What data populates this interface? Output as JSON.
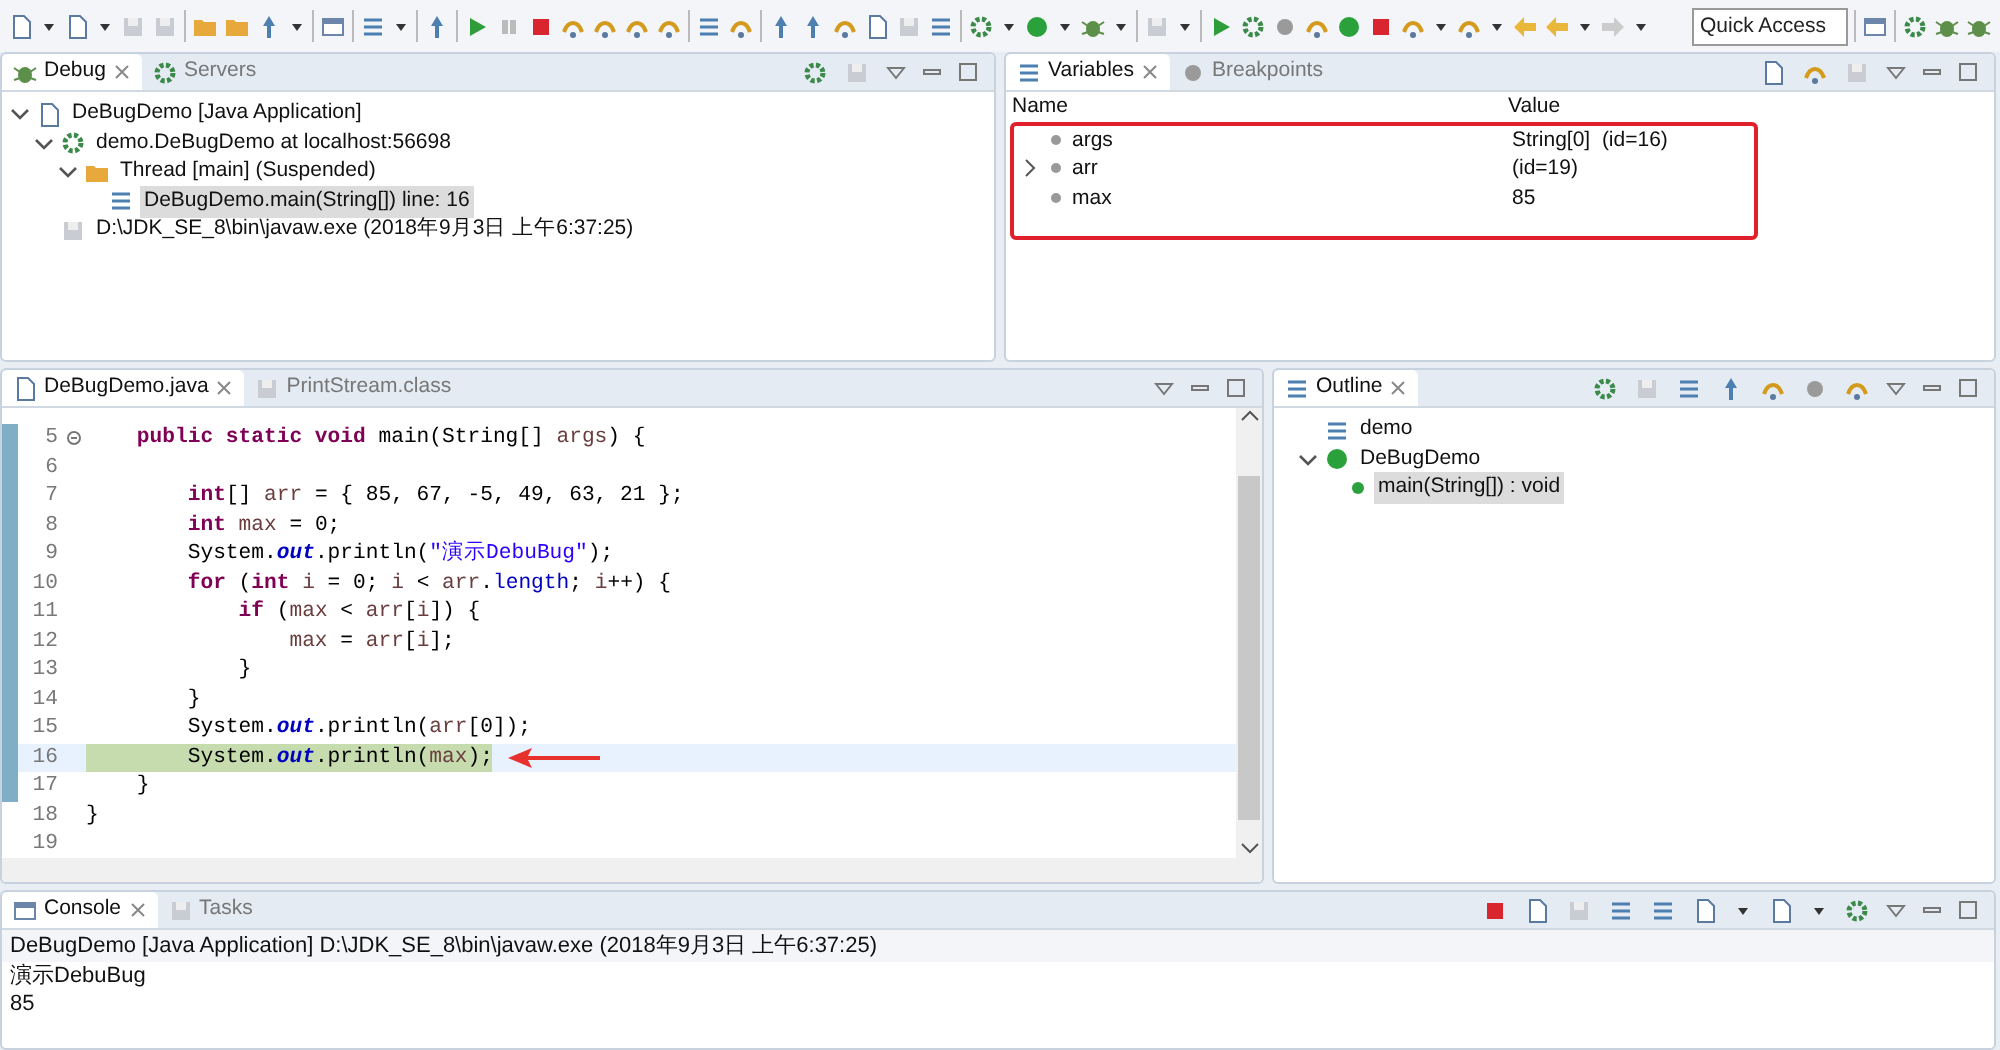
{
  "toolbar": {
    "quick_access": {
      "placeholder": "Quick Access"
    }
  },
  "debug_view": {
    "tabs": [
      {
        "label": "Debug",
        "selected": true
      },
      {
        "label": "Servers",
        "selected": false
      }
    ],
    "tree": [
      {
        "label": "DeBugDemo [Java Application]",
        "kind": "launch",
        "selected": false,
        "expanded": true,
        "children": [
          {
            "label": "demo.DeBugDemo at localhost:56698",
            "kind": "target",
            "selected": false,
            "expanded": true,
            "children": [
              {
                "label": "Thread [main] (Suspended)",
                "kind": "thread",
                "selected": false,
                "expanded": true,
                "children": [
                  {
                    "label": "DeBugDemo.main(String[]) line: 16",
                    "kind": "frame",
                    "selected": true
                  }
                ]
              }
            ]
          },
          {
            "label": "D:\\JDK_SE_8\\bin\\javaw.exe (2018年9月3日 上午6:37:25)",
            "kind": "process",
            "selected": false
          }
        ]
      }
    ]
  },
  "variables_view": {
    "tabs": [
      {
        "label": "Variables",
        "selected": true
      },
      {
        "label": "Breakpoints",
        "selected": false
      }
    ],
    "columns": [
      "Name",
      "Value"
    ],
    "rows": [
      {
        "name": "args",
        "value": "String[0]  (id=16)",
        "expandable": false
      },
      {
        "name": "arr",
        "value": "(id=19)",
        "expandable": true
      },
      {
        "name": "max",
        "value": "85",
        "expandable": false
      }
    ]
  },
  "editor": {
    "tabs": [
      {
        "label": "DeBugDemo.java",
        "selected": true
      },
      {
        "label": "PrintStream.class",
        "selected": false
      }
    ],
    "lines": [
      {
        "number": "5",
        "fold": true,
        "current": false,
        "segments": [
          {
            "kind": "kw",
            "text": "    public static void"
          },
          {
            "kind": "txt",
            "text": " main(String[] "
          },
          {
            "kind": "loc",
            "text": "args"
          },
          {
            "kind": "txt",
            "text": ") {"
          }
        ]
      },
      {
        "number": "6",
        "fold": false,
        "current": false
      },
      {
        "number": "7",
        "fold": false,
        "current": false,
        "segments": [
          {
            "kind": "kw",
            "text": "        int"
          },
          {
            "kind": "txt",
            "text": "[] "
          },
          {
            "kind": "loc",
            "text": "arr"
          },
          {
            "kind": "txt",
            "text": " = { 85, 67, -5, 49, 63, 21 };"
          }
        ]
      },
      {
        "number": "8",
        "fold": false,
        "current": false,
        "segments": [
          {
            "kind": "kw",
            "text": "        int "
          },
          {
            "kind": "loc",
            "text": "max"
          },
          {
            "kind": "txt",
            "text": " = 0;"
          }
        ]
      },
      {
        "number": "9",
        "fold": false,
        "current": false,
        "segments": [
          {
            "kind": "txt",
            "text": "        System."
          },
          {
            "kind": "fld",
            "text": "out"
          },
          {
            "kind": "txt",
            "text": ".println("
          },
          {
            "kind": "str",
            "text": "\"演示DebuBug\""
          },
          {
            "kind": "txt",
            "text": ");"
          }
        ]
      },
      {
        "number": "10",
        "fold": false,
        "current": false,
        "segments": [
          {
            "kind": "kw",
            "text": "        for"
          },
          {
            "kind": "txt",
            "text": " ("
          },
          {
            "kind": "kw",
            "text": "int "
          },
          {
            "kind": "loc",
            "text": "i"
          },
          {
            "kind": "txt",
            "text": " = 0; "
          },
          {
            "kind": "loc",
            "text": "i"
          },
          {
            "kind": "txt",
            "text": " < "
          },
          {
            "kind": "loc",
            "text": "arr"
          },
          {
            "kind": "txt",
            "text": "."
          },
          {
            "kind": "mem",
            "text": "length"
          },
          {
            "kind": "txt",
            "text": "; "
          },
          {
            "kind": "loc",
            "text": "i"
          },
          {
            "kind": "txt",
            "text": "++) {"
          }
        ]
      },
      {
        "number": "11",
        "fold": false,
        "current": false,
        "segments": [
          {
            "kind": "kw",
            "text": "            if"
          },
          {
            "kind": "txt",
            "text": " ("
          },
          {
            "kind": "loc",
            "text": "max"
          },
          {
            "kind": "txt",
            "text": " < "
          },
          {
            "kind": "loc",
            "text": "arr"
          },
          {
            "kind": "txt",
            "text": "["
          },
          {
            "kind": "loc",
            "text": "i"
          },
          {
            "kind": "txt",
            "text": "]) {"
          }
        ]
      },
      {
        "number": "12",
        "fold": false,
        "current": false,
        "segments": [
          {
            "kind": "loc",
            "text": "                max"
          },
          {
            "kind": "txt",
            "text": " = "
          },
          {
            "kind": "loc",
            "text": "arr"
          },
          {
            "kind": "txt",
            "text": "["
          },
          {
            "kind": "loc",
            "text": "i"
          },
          {
            "kind": "txt",
            "text": "];"
          }
        ]
      },
      {
        "number": "13",
        "fold": false,
        "current": false,
        "segments": [
          {
            "kind": "txt",
            "text": "            }"
          }
        ]
      },
      {
        "number": "14",
        "fold": false,
        "current": false,
        "segments": [
          {
            "kind": "txt",
            "text": "        }"
          }
        ]
      },
      {
        "number": "15",
        "fold": false,
        "current": false,
        "segments": [
          {
            "kind": "txt",
            "text": "        System."
          },
          {
            "kind": "fld",
            "text": "out"
          },
          {
            "kind": "txt",
            "text": ".println("
          },
          {
            "kind": "loc",
            "text": "arr"
          },
          {
            "kind": "txt",
            "text": "[0]);"
          }
        ]
      },
      {
        "number": "16",
        "fold": false,
        "current": true,
        "segments": [
          {
            "kind": "txt",
            "text": "        System."
          },
          {
            "kind": "fld",
            "text": "out"
          },
          {
            "kind": "txt",
            "text": ".println("
          },
          {
            "kind": "loc",
            "text": "max"
          },
          {
            "kind": "txt",
            "text": ");"
          }
        ]
      },
      {
        "number": "17",
        "fold": false,
        "current": false,
        "segments": [
          {
            "kind": "txt",
            "text": "    }"
          }
        ]
      },
      {
        "number": "18",
        "fold": false,
        "current": false,
        "segments": [
          {
            "kind": "txt",
            "text": "}"
          }
        ]
      },
      {
        "number": "19",
        "fold": false,
        "current": false
      }
    ]
  },
  "outline_view": {
    "tabs": [
      {
        "label": "Outline",
        "selected": true
      }
    ],
    "tree": [
      {
        "label": "demo",
        "kind": "package",
        "selected": false
      },
      {
        "label": "DeBugDemo",
        "kind": "class",
        "selected": false,
        "expanded": true,
        "children": [
          {
            "label": "main(String[]) : void",
            "kind": "method",
            "selected": true
          }
        ]
      }
    ]
  },
  "console_view": {
    "tabs": [
      {
        "label": "Console",
        "selected": true
      },
      {
        "label": "Tasks",
        "selected": false
      }
    ],
    "header": "DeBugDemo [Java Application] D:\\JDK_SE_8\\bin\\javaw.exe (2018年9月3日 上午6:37:25)",
    "output": [
      "演示DebuBug",
      "85"
    ]
  }
}
